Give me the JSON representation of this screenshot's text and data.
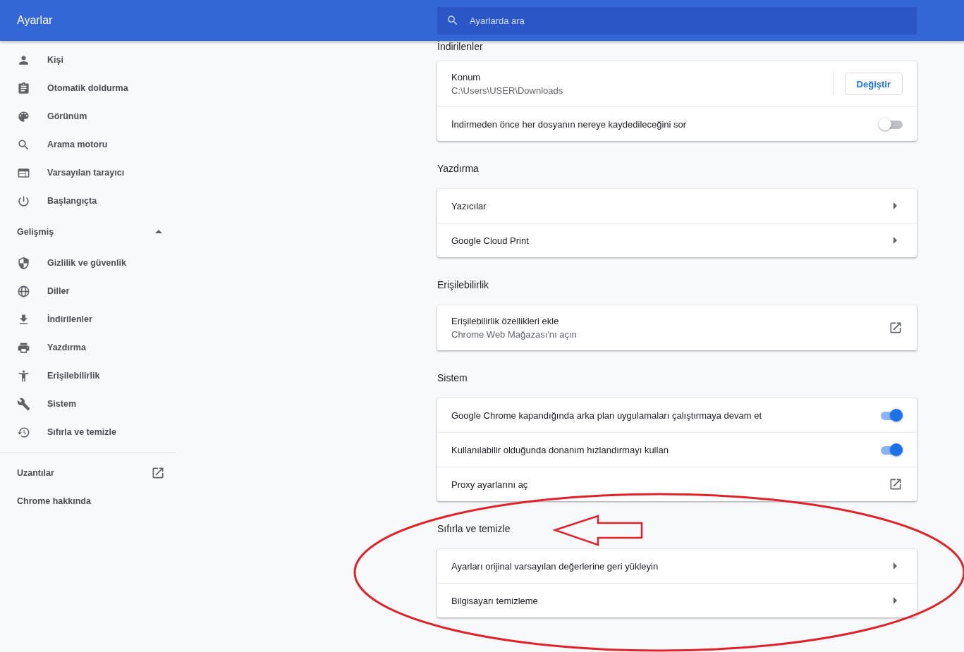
{
  "header": {
    "title": "Ayarlar",
    "search": {
      "placeholder": "Ayarlarda ara"
    }
  },
  "sidebar": {
    "items": [
      {
        "label": "Kişi"
      },
      {
        "label": "Otomatik doldurma"
      },
      {
        "label": "Görünüm"
      },
      {
        "label": "Arama motoru"
      },
      {
        "label": "Varsayılan tarayıcı"
      },
      {
        "label": "Başlangıçta"
      }
    ],
    "advanced": {
      "label": "Gelişmiş",
      "expanded": true,
      "items": [
        {
          "label": "Gizlilik ve güvenlik"
        },
        {
          "label": "Diller"
        },
        {
          "label": "İndirilenler"
        },
        {
          "label": "Yazdırma"
        },
        {
          "label": "Erişilebilirlik"
        },
        {
          "label": "Sistem"
        },
        {
          "label": "Sıfırla ve temizle"
        }
      ]
    },
    "footer_items": [
      {
        "label": "Uzantılar",
        "kind": "external"
      },
      {
        "label": "Chrome hakkında",
        "kind": "plain"
      }
    ]
  },
  "sections": [
    {
      "title": "İndirilenler",
      "rows": [
        {
          "kind": "button",
          "label": "Konum",
          "sublabel": "C:\\Users\\USER\\Downloads",
          "button": "Değiştir"
        },
        {
          "kind": "toggle",
          "label": "İndirmeden önce her dosyanın nereye kaydedileceğini sor",
          "on": false
        }
      ]
    },
    {
      "title": "Yazdırma",
      "rows": [
        {
          "kind": "link",
          "label": "Yazıcılar"
        },
        {
          "kind": "link",
          "label": "Google Cloud Print"
        }
      ]
    },
    {
      "title": "Erişilebilirlik",
      "rows": [
        {
          "kind": "external",
          "label": "Erişilebilirlik özellikleri ekle",
          "sublabel": "Chrome Web Mağazası'nı açın"
        }
      ]
    },
    {
      "title": "Sistem",
      "rows": [
        {
          "kind": "toggle",
          "label": "Google Chrome kapandığında arka plan uygulamaları çalıştırmaya devam et",
          "on": true
        },
        {
          "kind": "toggle",
          "label": "Kullanılabilir olduğunda donanım hızlandırmayı kullan",
          "on": true
        },
        {
          "kind": "external",
          "label": "Proxy ayarlarını aç"
        }
      ]
    },
    {
      "title": "Sıfırla ve temizle",
      "rows": [
        {
          "kind": "link",
          "label": "Ayarları orijinal varsayılan değerlerine geri yükleyin"
        },
        {
          "kind": "link",
          "label": "Bilgisayarı temizleme"
        }
      ]
    }
  ],
  "annotations": {
    "ellipse": {
      "color": "#e0222a"
    },
    "arrow": {
      "color": "#e0222a"
    }
  }
}
